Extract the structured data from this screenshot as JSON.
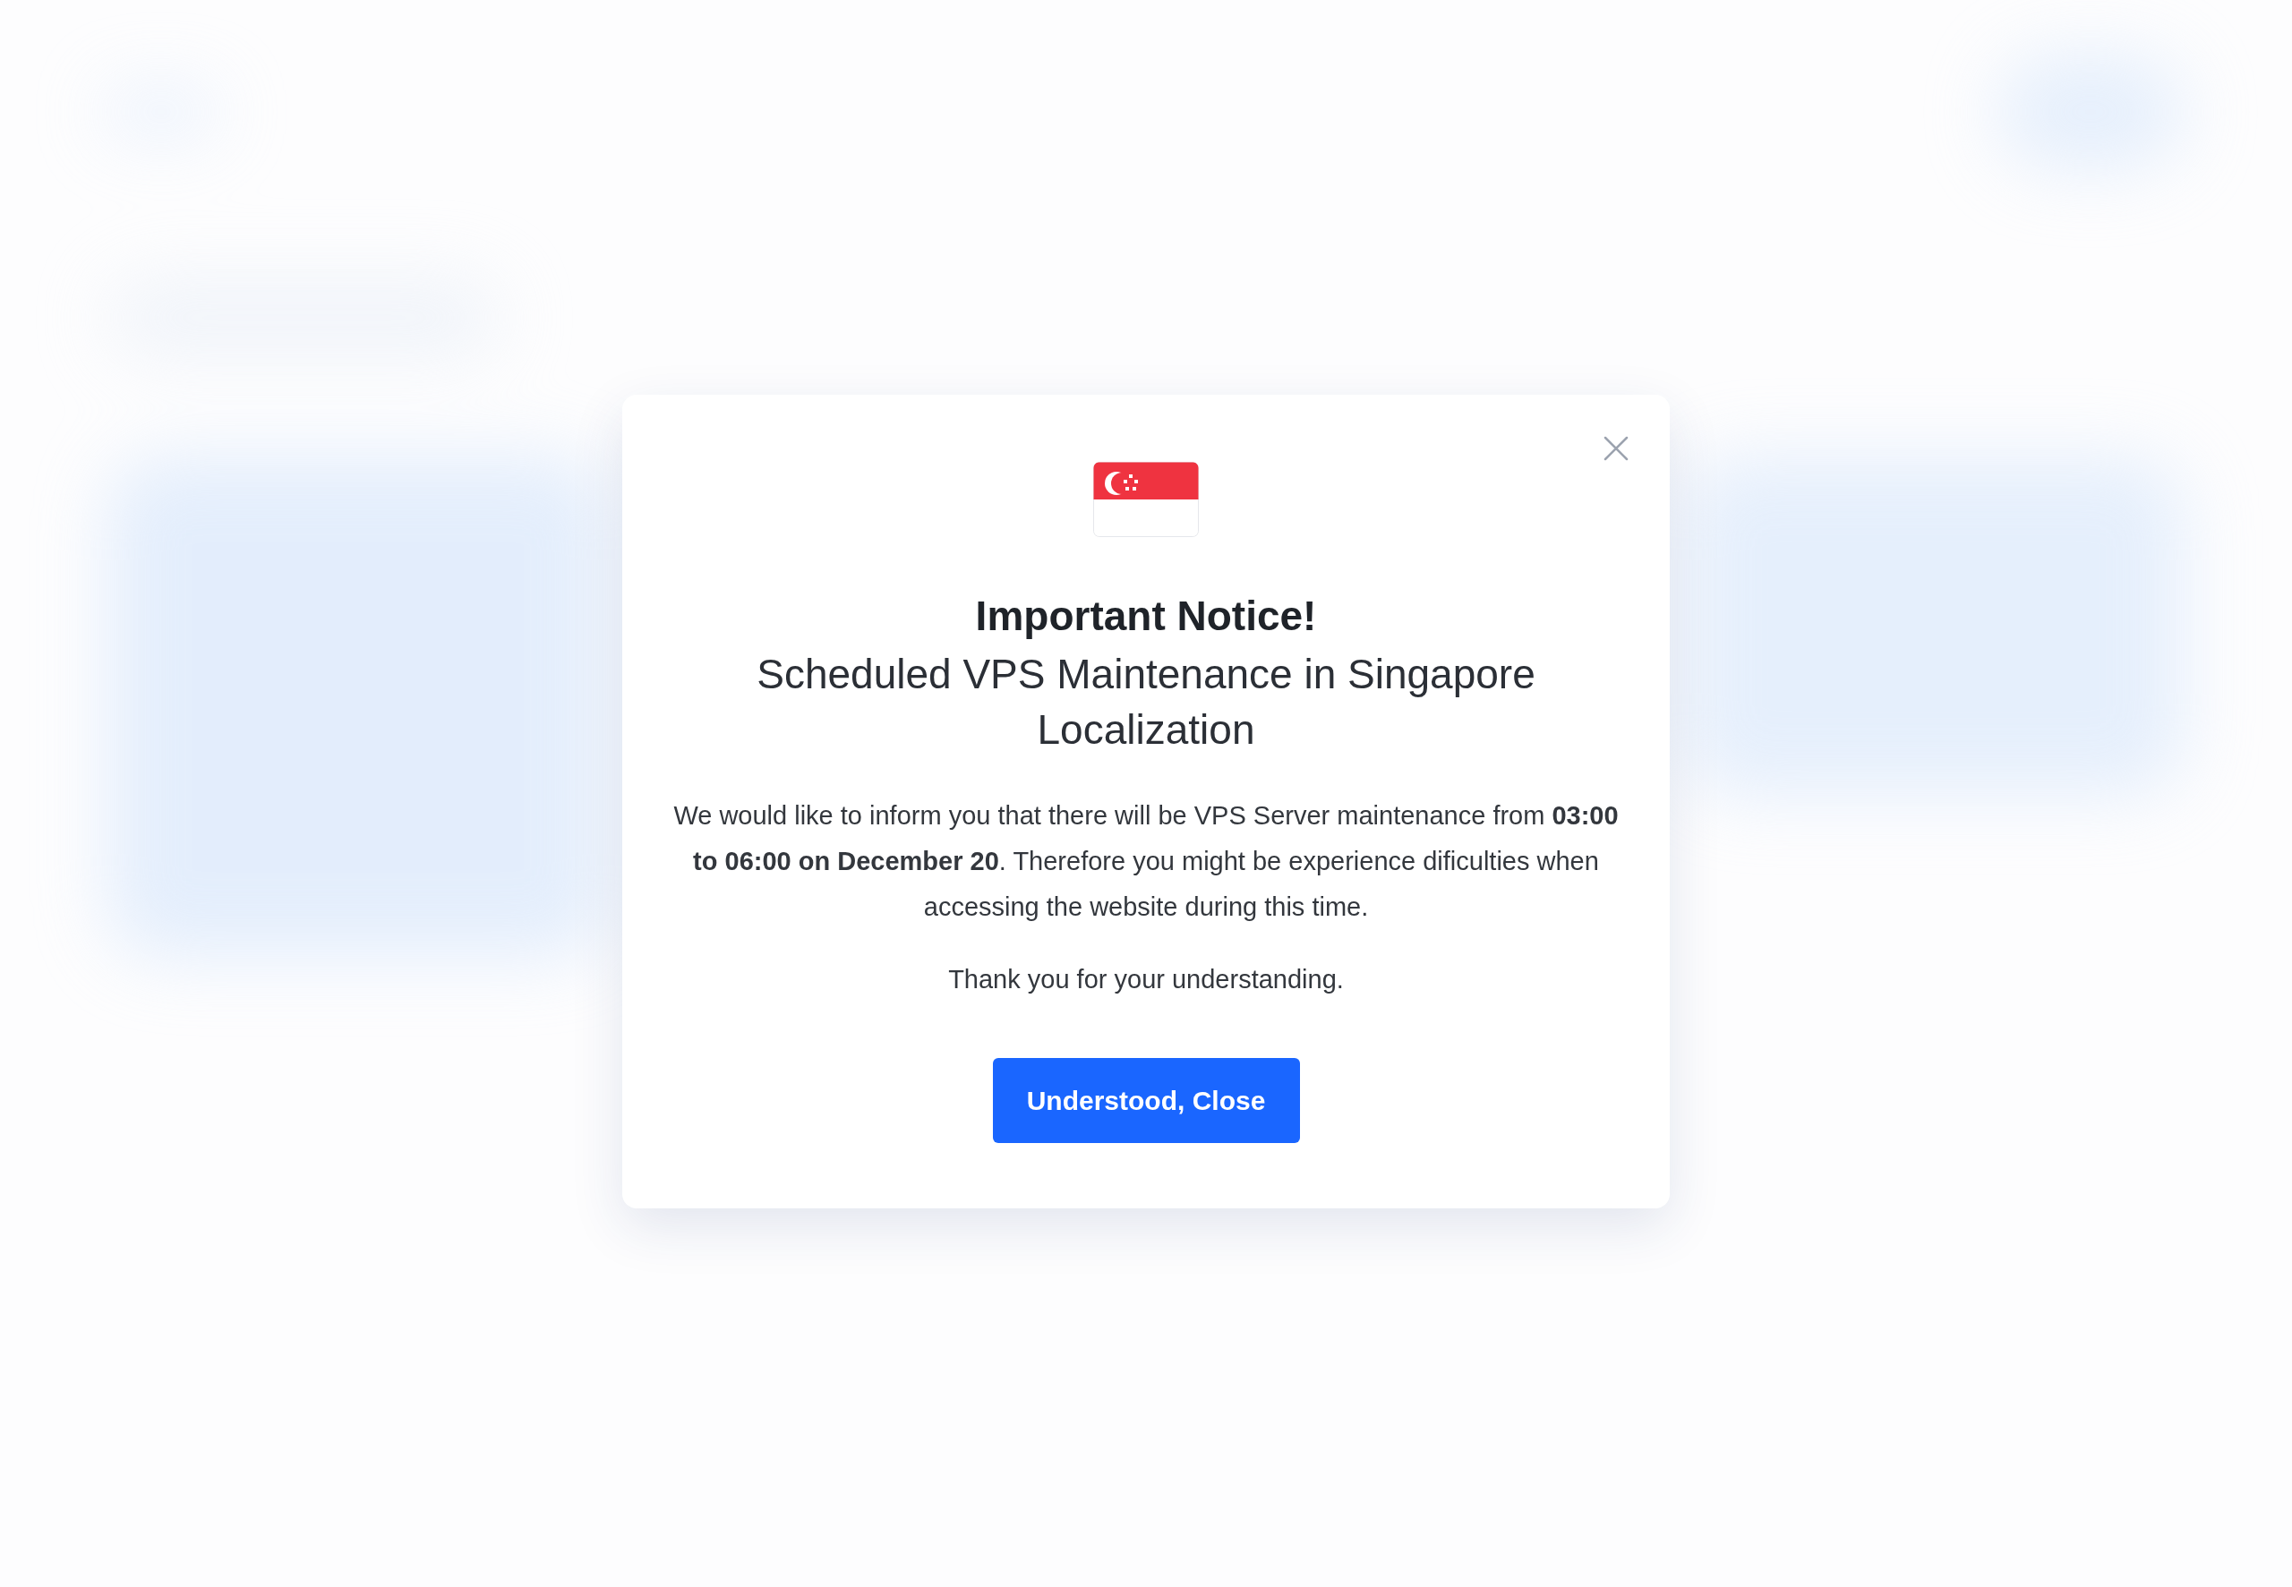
{
  "notice": {
    "title": "Important Notice!",
    "subtitle": "Scheduled VPS Maintenance in Singapore Localization",
    "message": "We would like to inform you that there will be VPS Server maintenance from **03:00 to 06:00 on December 20**. Therefore you might be experience dificulties when accessing the website during this time.",
    "thanks": "Thank you for your understanding.",
    "button": "Understood, Close"
  }
}
